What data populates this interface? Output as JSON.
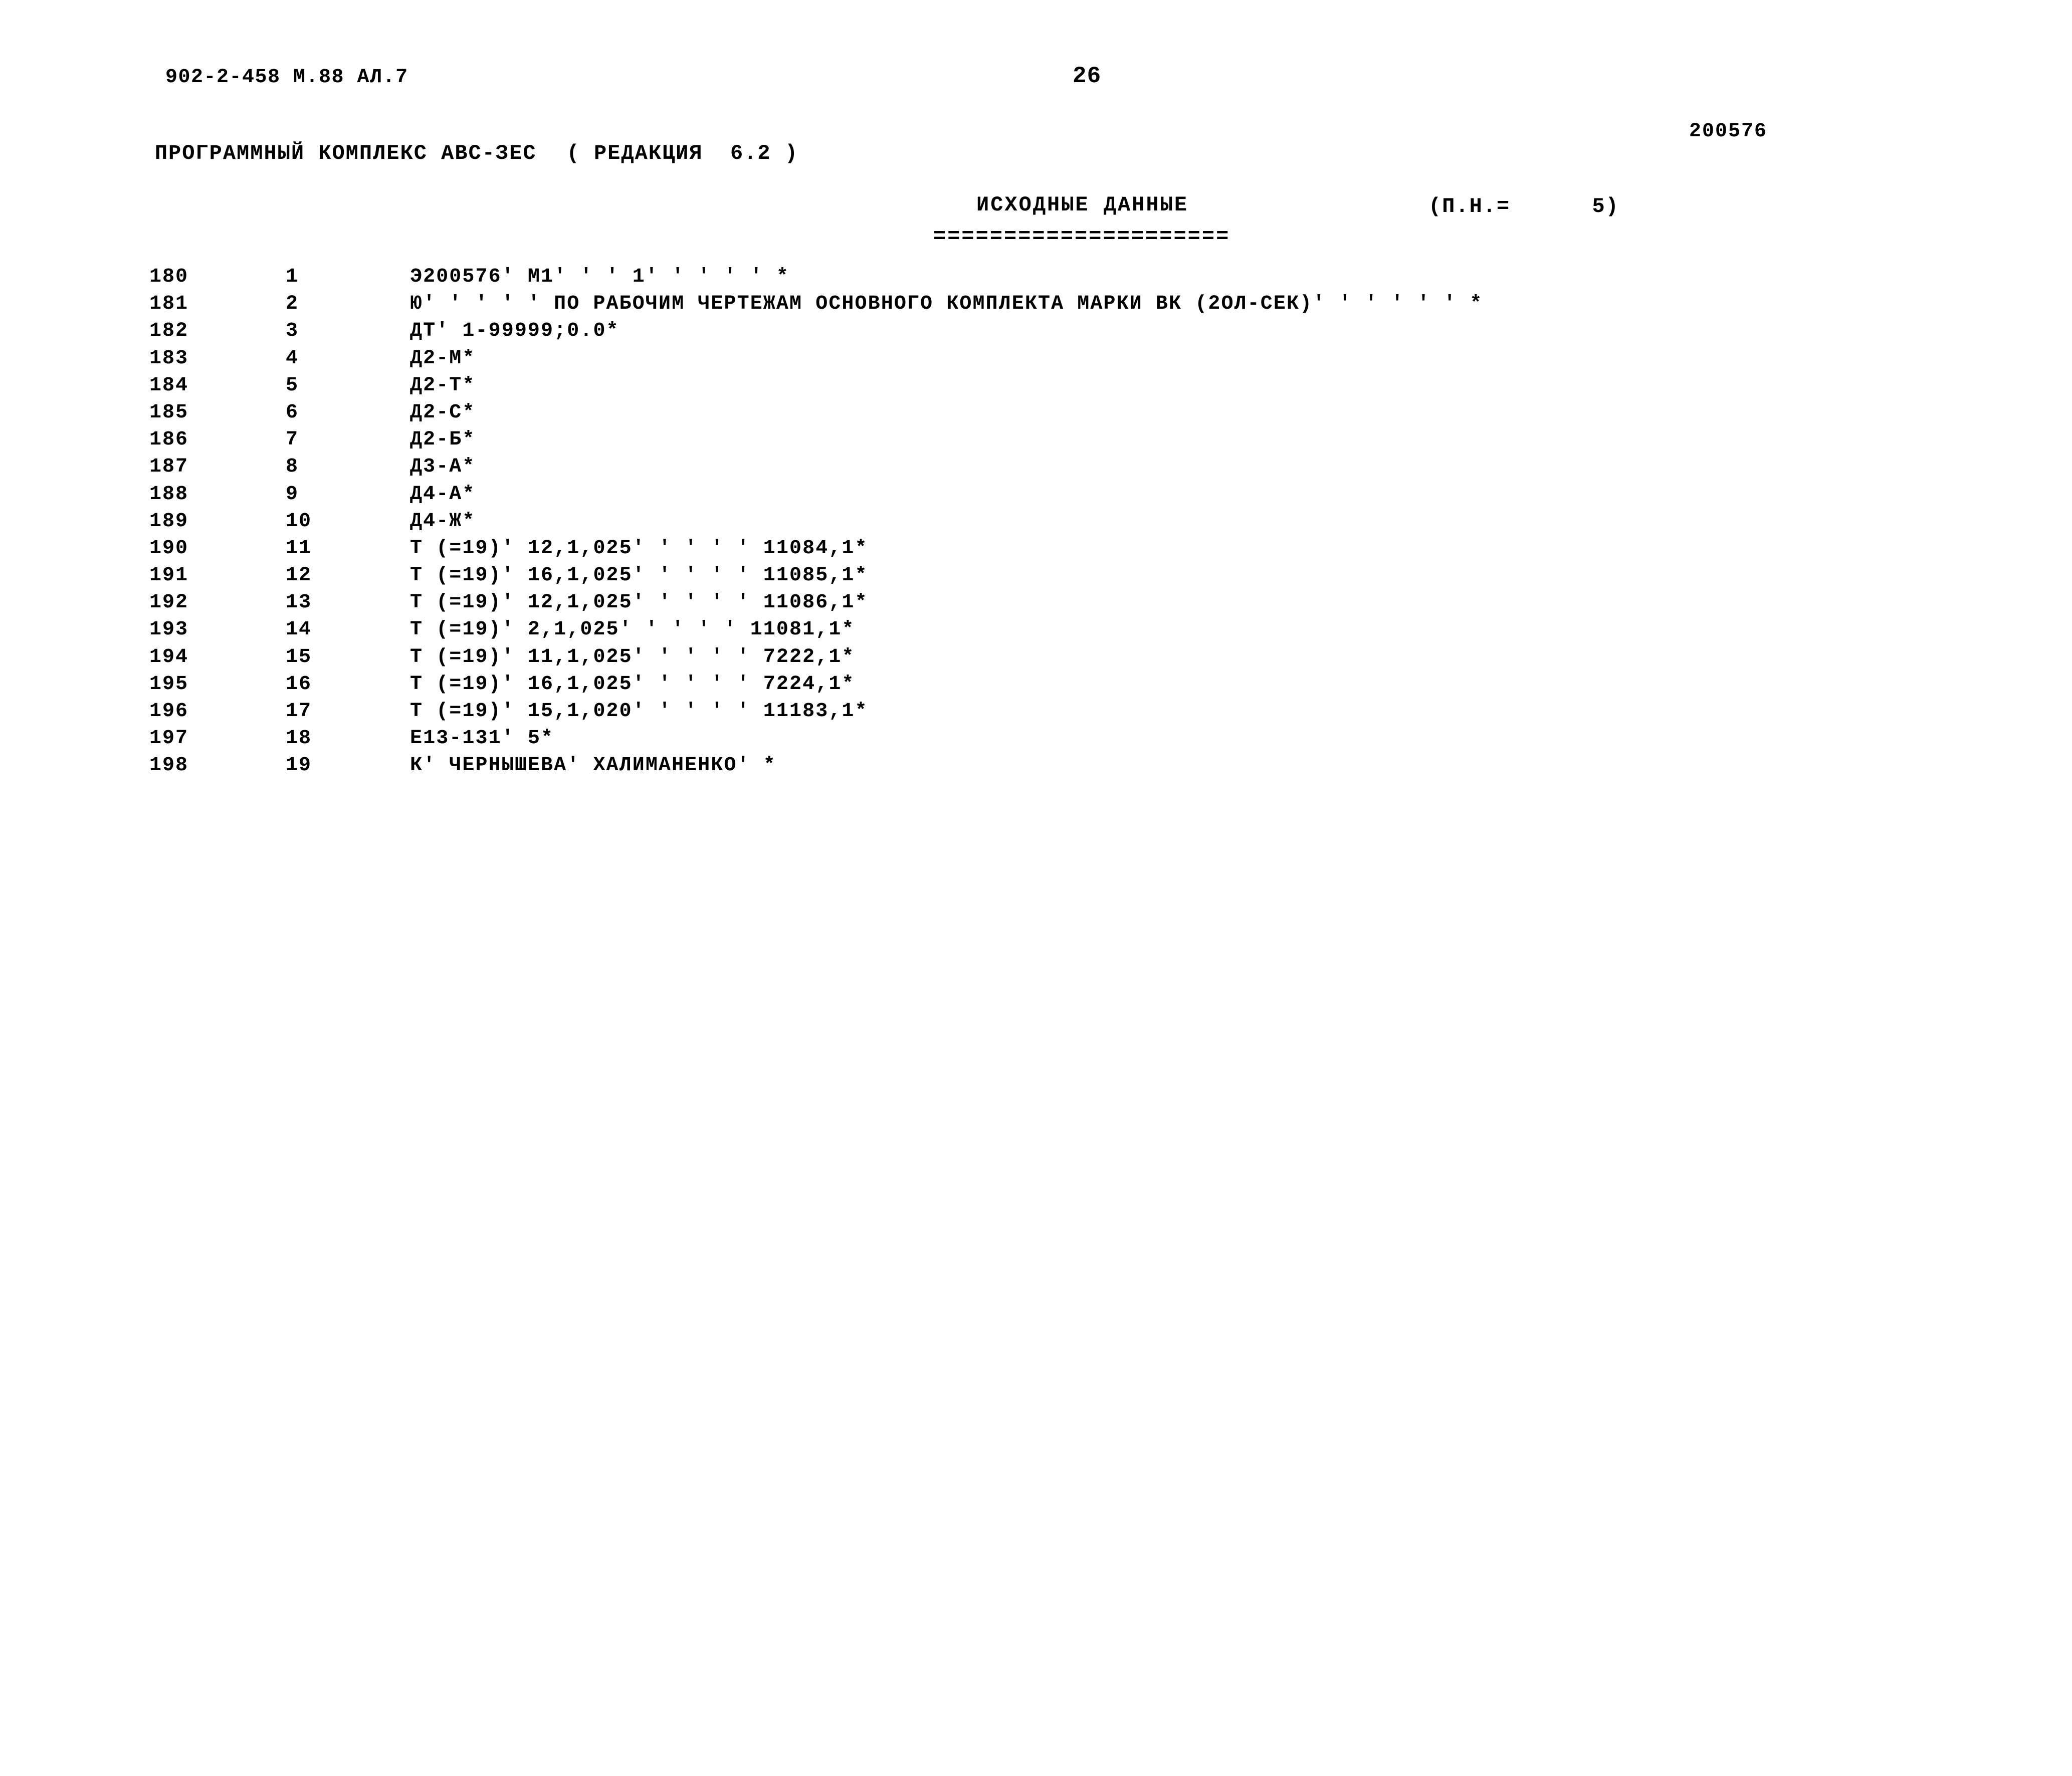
{
  "header": {
    "doc_ref": "902-2-458 М.88 АЛ.7",
    "page_number": "26",
    "program_complex": "ПРОГРАММНЫЙ КОМПЛЕКС АВС-ЗЕС",
    "edition": "( РЕДАКЦИЯ  6.2 )",
    "run_number": "200576"
  },
  "section": {
    "title": "ИСХОДНЫЕ ДАННЫЕ",
    "meta": "(П.Н.=      5)",
    "rule": "====================="
  },
  "listing": {
    "rows": [
      {
        "seq": "180",
        "idx": "1",
        "text": "Э200576' М1' ' ' 1' ' ' ' ' *"
      },
      {
        "seq": "181",
        "idx": "2",
        "text": "Ю' ' ' ' ' ПО РАБОЧИМ ЧЕРТЕЖАМ ОСНОВНОГО КОМПЛЕКТА МАРКИ ВК (2ОЛ-СЕК)' ' ' ' ' ' *"
      },
      {
        "seq": "182",
        "idx": "3",
        "text": "ДТ' 1-99999;0.0*"
      },
      {
        "seq": "183",
        "idx": "4",
        "text": "Д2-М*"
      },
      {
        "seq": "184",
        "idx": "5",
        "text": "Д2-Т*"
      },
      {
        "seq": "185",
        "idx": "6",
        "text": "Д2-С*"
      },
      {
        "seq": "186",
        "idx": "7",
        "text": "Д2-Б*"
      },
      {
        "seq": "187",
        "idx": "8",
        "text": "Д3-А*"
      },
      {
        "seq": "188",
        "idx": "9",
        "text": "Д4-А*"
      },
      {
        "seq": "189",
        "idx": "10",
        "text": "Д4-Ж*"
      },
      {
        "seq": "190",
        "idx": "11",
        "text": "Т (=19)' 12,1,025' ' ' ' ' 11084,1*"
      },
      {
        "seq": "191",
        "idx": "12",
        "text": "Т (=19)' 16,1,025' ' ' ' ' 11085,1*"
      },
      {
        "seq": "192",
        "idx": "13",
        "text": "Т (=19)' 12,1,025' ' ' ' ' 11086,1*"
      },
      {
        "seq": "193",
        "idx": "14",
        "text": "Т (=19)' 2,1,025' ' ' ' ' 11081,1*"
      },
      {
        "seq": "194",
        "idx": "15",
        "text": "Т (=19)' 11,1,025' ' ' ' ' 7222,1*"
      },
      {
        "seq": "195",
        "idx": "16",
        "text": "Т (=19)' 16,1,025' ' ' ' ' 7224,1*"
      },
      {
        "seq": "196",
        "idx": "17",
        "text": "Т (=19)' 15,1,020' ' ' ' ' 11183,1*"
      },
      {
        "seq": "197",
        "idx": "18",
        "text": "Е13-131' 5*"
      },
      {
        "seq": "198",
        "idx": "19",
        "text": "К' ЧЕРНЫШЕВА' ХАЛИМАНЕНКО' *"
      }
    ]
  }
}
